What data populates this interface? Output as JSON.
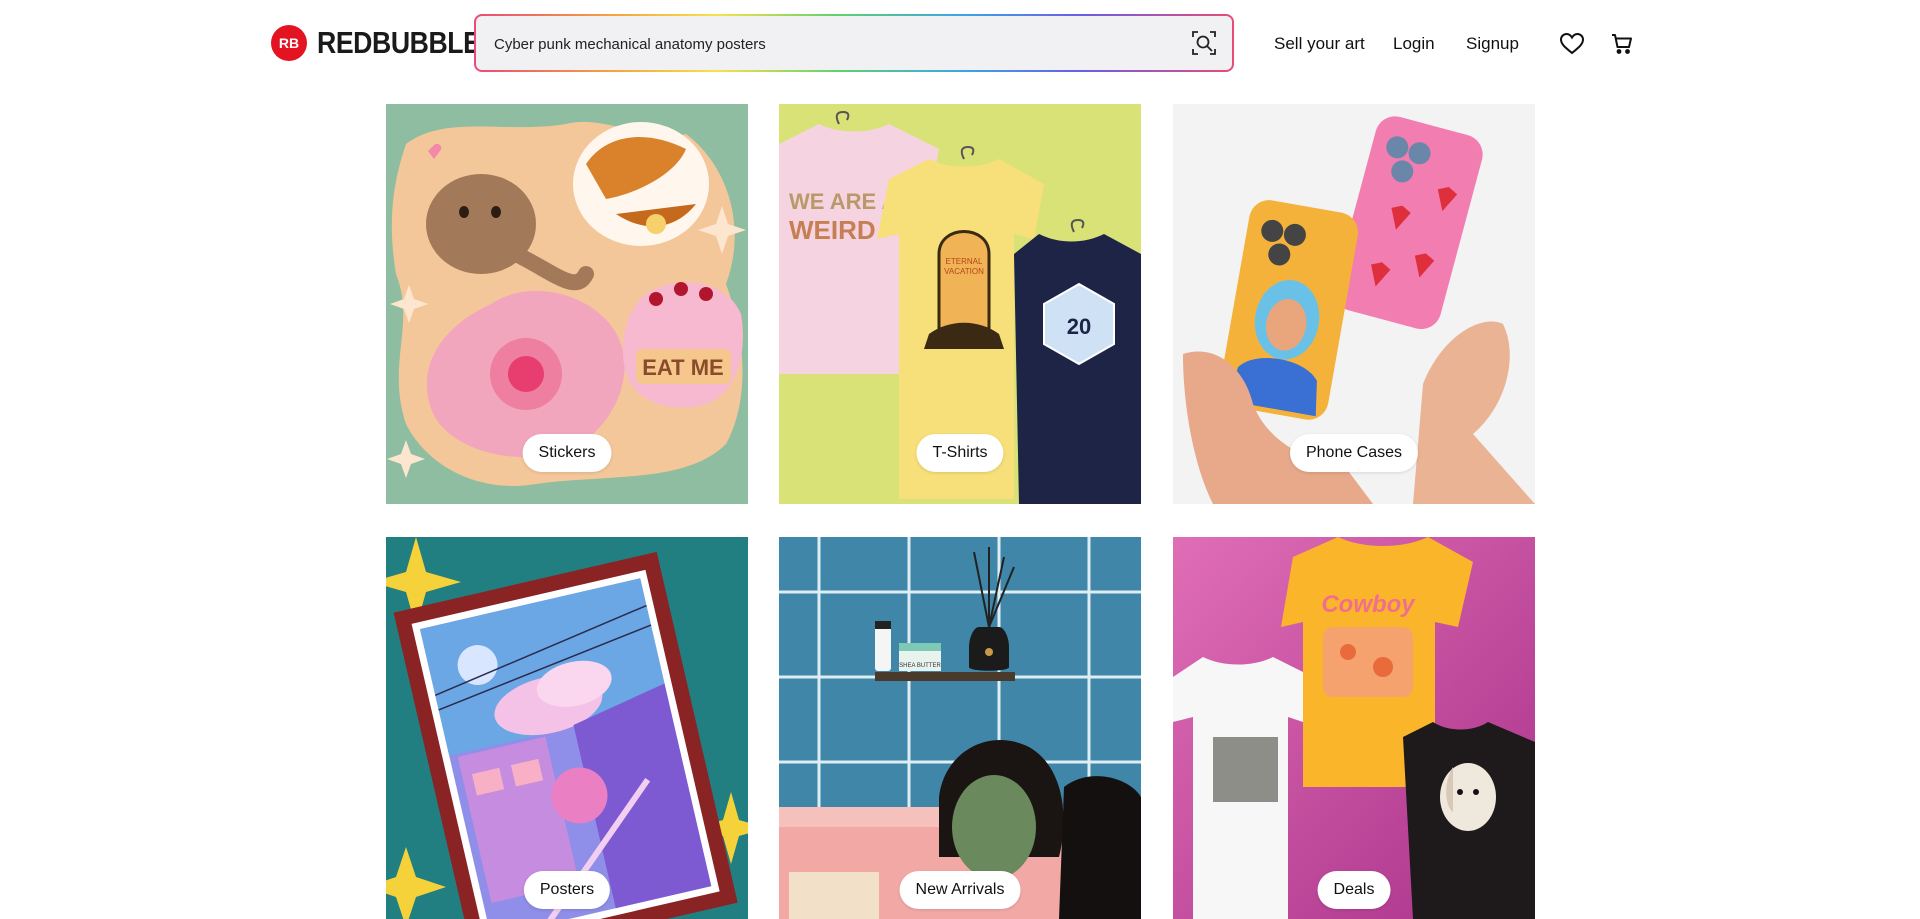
{
  "brand": {
    "name": "REDBUBBLE"
  },
  "search": {
    "value": "Cyber punk mechanical anatomy posters",
    "icon": "visual-search-icon"
  },
  "nav": {
    "sell": "Sell your art",
    "login": "Login",
    "signup": "Signup",
    "wishlist_icon": "heart-icon",
    "cart_icon": "cart-icon"
  },
  "categories": [
    {
      "label": "Stickers"
    },
    {
      "label": "T-Shirts"
    },
    {
      "label": "Phone Cases"
    },
    {
      "label": "Posters"
    },
    {
      "label": "New Arrivals"
    },
    {
      "label": "Deals"
    }
  ],
  "colors": {
    "brand_red": "#e41321"
  }
}
